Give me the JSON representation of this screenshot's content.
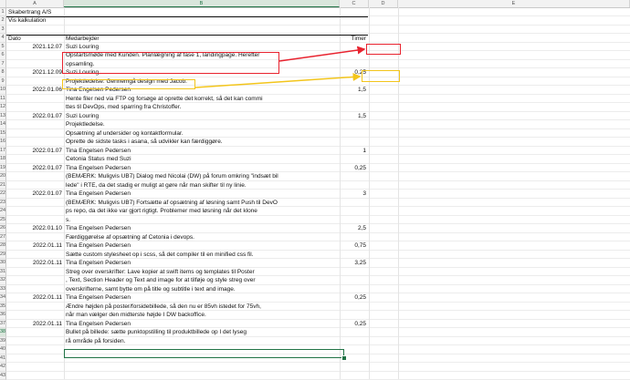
{
  "columns": [
    "A",
    "B",
    "C",
    "D",
    "E"
  ],
  "rows": [
    {
      "n": "1",
      "b": "",
      "c": "",
      "d": ""
    },
    {
      "n": "2",
      "b": "",
      "c": "",
      "d": ""
    },
    {
      "n": "3",
      "b": "",
      "c": "",
      "d": ""
    },
    {
      "n": "4",
      "b": "",
      "c": "",
      "d": ""
    }
  ],
  "header": {
    "company": "Skabertrang  A/S",
    "subtitle": "Vis kalkulation",
    "col_date": "Dato",
    "col_employee": "Medarbejder",
    "col_hours": "Timer"
  },
  "cells": [
    {
      "row": 5,
      "date": "2021.12.07",
      "text": "Suzi Louring",
      "hours": ""
    },
    {
      "row": 6,
      "date": "",
      "text": "Opstartsmøde med Kunden. Planlægning af fase 1, landingpage. Herefter",
      "hours": ""
    },
    {
      "row": 7,
      "date": "",
      "text": "opsamling.",
      "hours": ""
    },
    {
      "row": 8,
      "date": "2021.12.09",
      "text": "Suzi Louring",
      "hours": "0,25"
    },
    {
      "row": 9,
      "date": "",
      "text": "Projektledelse: Gennemgå design med Jacob.",
      "hours": ""
    },
    {
      "row": 10,
      "date": "2022.01.06",
      "text": "Tina Engelsen Pedersen",
      "hours": "1,5"
    },
    {
      "row": 11,
      "date": "",
      "text": "Hente filer ned via FTP og forsøge at oprette det korrekt, så det kan commi",
      "hours": ""
    },
    {
      "row": 12,
      "date": "",
      "text": "ttes til DevOps, med sparring fra Christoffer.",
      "hours": ""
    },
    {
      "row": 13,
      "date": "2022.01.07",
      "text": "Suzi Louring",
      "hours": "1,5"
    },
    {
      "row": 14,
      "date": "",
      "text": "Projektledelse.",
      "hours": ""
    },
    {
      "row": 15,
      "date": "",
      "text": "Opsætning af undersider og kontaktformular.",
      "hours": ""
    },
    {
      "row": 16,
      "date": "",
      "text": "Oprette de sidste tasks i asana, så udvikler kan færdiggøre.",
      "hours": ""
    },
    {
      "row": 17,
      "date": "2022.01.07",
      "text": "Tina Engelsen Pedersen",
      "hours": "1"
    },
    {
      "row": 18,
      "date": "",
      "text": "Cetonia Status med Suzi",
      "hours": ""
    },
    {
      "row": 19,
      "date": "2022.01.07",
      "text": "Tina Engelsen Pedersen",
      "hours": "0,25"
    },
    {
      "row": 20,
      "date": "",
      "text": "(BEMÆRK: Muligvis UB7) Dialog med Nicolai (DW) på forum omkring \"indsæt bil",
      "hours": ""
    },
    {
      "row": 21,
      "date": "",
      "text": "lede\" i RTE, da det stadig er muligt at gøre når man skifter til ny linie.",
      "hours": ""
    },
    {
      "row": 22,
      "date": "2022.01.07",
      "text": "Tina Engelsen Pedersen",
      "hours": "3"
    },
    {
      "row": 23,
      "date": "",
      "text": "(BEMÆRK: Muligvis UB7) Fortsætte af opsætning af løsning samt Push til DevO",
      "hours": ""
    },
    {
      "row": 24,
      "date": "",
      "text": "ps repo, da det ikke var gjort rigtigt. Problemer med løsning når det klone",
      "hours": ""
    },
    {
      "row": 25,
      "date": "",
      "text": "s.",
      "hours": ""
    },
    {
      "row": 26,
      "date": "2022.01.10",
      "text": "Tina Engelsen Pedersen",
      "hours": "2,5"
    },
    {
      "row": 27,
      "date": "",
      "text": "Færdiggørelse af opsætning af Cetonia i devops.",
      "hours": ""
    },
    {
      "row": 28,
      "date": "2022.01.11",
      "text": "Tina Engelsen Pedersen",
      "hours": "0,75"
    },
    {
      "row": 29,
      "date": "",
      "text": "Sætte custom stylesheet op i scss, så det compiler til en minified css fil.",
      "hours": ""
    },
    {
      "row": 30,
      "date": "2022.01.11",
      "text": "Tina Engelsen Pedersen",
      "hours": "3,25"
    },
    {
      "row": 31,
      "date": "",
      "text": "Streg over overskrifter: Lave kopier at swift items og templates til Poster",
      "hours": ""
    },
    {
      "row": 32,
      "date": "",
      "text": ", Text, Section Header og Text and image for at tilføje og style streg over",
      "hours": ""
    },
    {
      "row": 33,
      "date": "",
      "text": " overskrifterne, samt bytte om på title og subtitle i text and image.",
      "hours": ""
    },
    {
      "row": 34,
      "date": "2022.01.11",
      "text": "Tina Engelsen Pedersen",
      "hours": "0,25"
    },
    {
      "row": 35,
      "date": "",
      "text": "Ændre højden på poster/forsidebillede, så den nu er 85vh istedet for 75vh,",
      "hours": ""
    },
    {
      "row": 36,
      "date": "",
      "text": "når man vælger den midterste højde I DW backoffice.",
      "hours": ""
    },
    {
      "row": 37,
      "date": "2022.01.11",
      "text": "Tina Engelsen Pedersen",
      "hours": "0,25"
    },
    {
      "row": 38,
      "date": "",
      "text": "Bullet på billede: sætte punktopstilling til produktbillede op I det  lyseg",
      "hours": ""
    },
    {
      "row": 39,
      "date": "",
      "text": "rå område på forsiden.",
      "hours": ""
    }
  ],
  "colors": {
    "annotation_red": "#e8232f",
    "annotation_yellow": "#f3c51b",
    "selection_green": "#217346"
  }
}
